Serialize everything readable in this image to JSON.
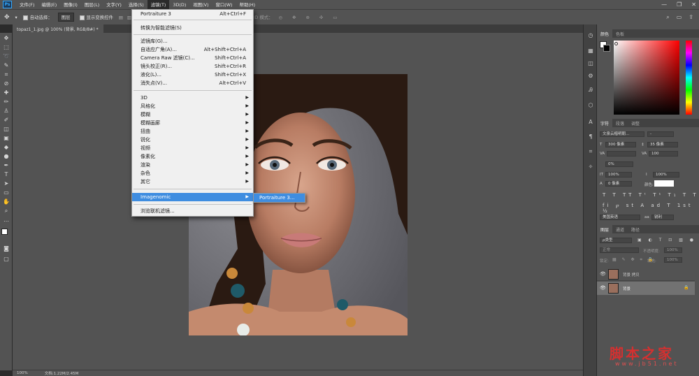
{
  "menubar": {
    "app_icon": "Ps",
    "items": [
      "文件(F)",
      "编辑(E)",
      "图像(I)",
      "图层(L)",
      "文字(Y)",
      "选择(S)",
      "滤镜(T)",
      "3D(D)",
      "视图(V)",
      "窗口(W)",
      "帮助(H)"
    ],
    "active_index": 6
  },
  "options_bar": {
    "auto_select_label": "自动选择：",
    "auto_select_value": "图层",
    "show_transform_label": "显示变换控件",
    "mode_3d_label": "3D 模式："
  },
  "document_tab": {
    "title": "topaz1_1.jpg @ 100% (背景, RGB/8#) *",
    "close": "×"
  },
  "status_bar": {
    "zoom": "100%",
    "doc_info": "文档:1.22M/2.45M"
  },
  "filter_menu": {
    "items": [
      {
        "label": "Portraiture 3",
        "shortcut": "Alt+Ctrl+F"
      },
      {
        "label": "转换为智能滤镜(S)",
        "shortcut": ""
      },
      {
        "label": "滤镜库(G)...",
        "shortcut": ""
      },
      {
        "label": "自适应广角(A)...",
        "shortcut": "Alt+Shift+Ctrl+A"
      },
      {
        "label": "Camera Raw 滤镜(C)...",
        "shortcut": "Shift+Ctrl+A"
      },
      {
        "label": "镜头校正(R)...",
        "shortcut": "Shift+Ctrl+R"
      },
      {
        "label": "液化(L)...",
        "shortcut": "Shift+Ctrl+X"
      },
      {
        "label": "消失点(V)...",
        "shortcut": "Alt+Ctrl+V"
      },
      {
        "label": "3D",
        "submenu": true
      },
      {
        "label": "风格化",
        "submenu": true
      },
      {
        "label": "模糊",
        "submenu": true
      },
      {
        "label": "模糊画廊",
        "submenu": true
      },
      {
        "label": "扭曲",
        "submenu": true
      },
      {
        "label": "锐化",
        "submenu": true
      },
      {
        "label": "视频",
        "submenu": true
      },
      {
        "label": "像素化",
        "submenu": true
      },
      {
        "label": "渲染",
        "submenu": true
      },
      {
        "label": "杂色",
        "submenu": true
      },
      {
        "label": "其它",
        "submenu": true
      },
      {
        "label": "Imagenomic",
        "submenu": true,
        "highlighted": true
      },
      {
        "label": "浏览联机滤镜...",
        "shortcut": ""
      }
    ],
    "submenu_item": "Portraiture 3..."
  },
  "color_panel": {
    "tabs": [
      "颜色",
      "色板"
    ],
    "active_tab": 0,
    "hue_color": "#ff0000"
  },
  "character_panel": {
    "tabs": [
      "字符",
      "段落",
      "调整"
    ],
    "active_tab": 0,
    "font_family": "文泉云楷明朝...",
    "font_style": "-",
    "font_size": "300 像素",
    "leading": "35 像素",
    "kerning": "",
    "tracking": "100",
    "scale_pct": "0%",
    "vertical_scale": "100%",
    "horizontal_scale": "100%",
    "baseline_shift": "0 像素",
    "color_label": "颜色:",
    "language": "美国英语",
    "anti_alias": "锐利"
  },
  "layers_panel": {
    "tabs": [
      "图层",
      "通道",
      "路径"
    ],
    "active_tab": 0,
    "filter_kind": "ρ类型",
    "blend_mode": "正常",
    "opacity_label": "不透明度:",
    "opacity_value": "100%",
    "lock_label": "锁定:",
    "fill_label": "填充:",
    "fill_value": "100%",
    "layers": [
      {
        "name": "背景 拷贝",
        "locked": false,
        "selected": false
      },
      {
        "name": "背景",
        "locked": true,
        "selected": true
      }
    ]
  },
  "watermark": {
    "main": "脚本之家",
    "sub": "www.jb51.net"
  }
}
